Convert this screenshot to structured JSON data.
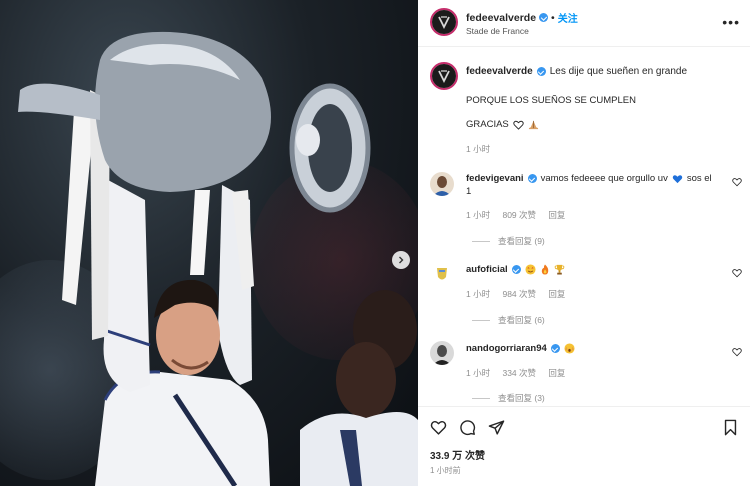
{
  "header": {
    "username": "fedeevalverde",
    "separator": "•",
    "follow_label": "关注",
    "location": "Stade de France"
  },
  "caption": {
    "username": "fedeevalverde",
    "line1": "Les dije que sueñen en grande",
    "line2": "PORQUE LOS SUEÑOS SE CUMPLEN",
    "line3": "GRACIAS",
    "time": "1 小时"
  },
  "comments": [
    {
      "username": "fedevigevani",
      "text": "vamos fedeeee que orgullo uv",
      "text_after": "sos el",
      "text_line2": "1",
      "time": "1 小时",
      "likes": "809 次赞",
      "reply": "回复",
      "view_replies": "查看回复 (9)"
    },
    {
      "username": "aufoficial",
      "time": "1 小时",
      "likes": "984 次赞",
      "reply": "回复",
      "view_replies": "查看回复 (6)"
    },
    {
      "username": "nandogorriaran94",
      "time": "1 小时",
      "likes": "334 次赞",
      "reply": "回复",
      "view_replies": "查看回复 (3)"
    }
  ],
  "footer": {
    "likes": "33.9 万 次赞",
    "posted": "1 小时前"
  },
  "colors": {
    "verified": "#3897f0",
    "follow": "#0095f6",
    "story_ring": "#c52d6b",
    "meta_text": "#8e8e8e"
  }
}
